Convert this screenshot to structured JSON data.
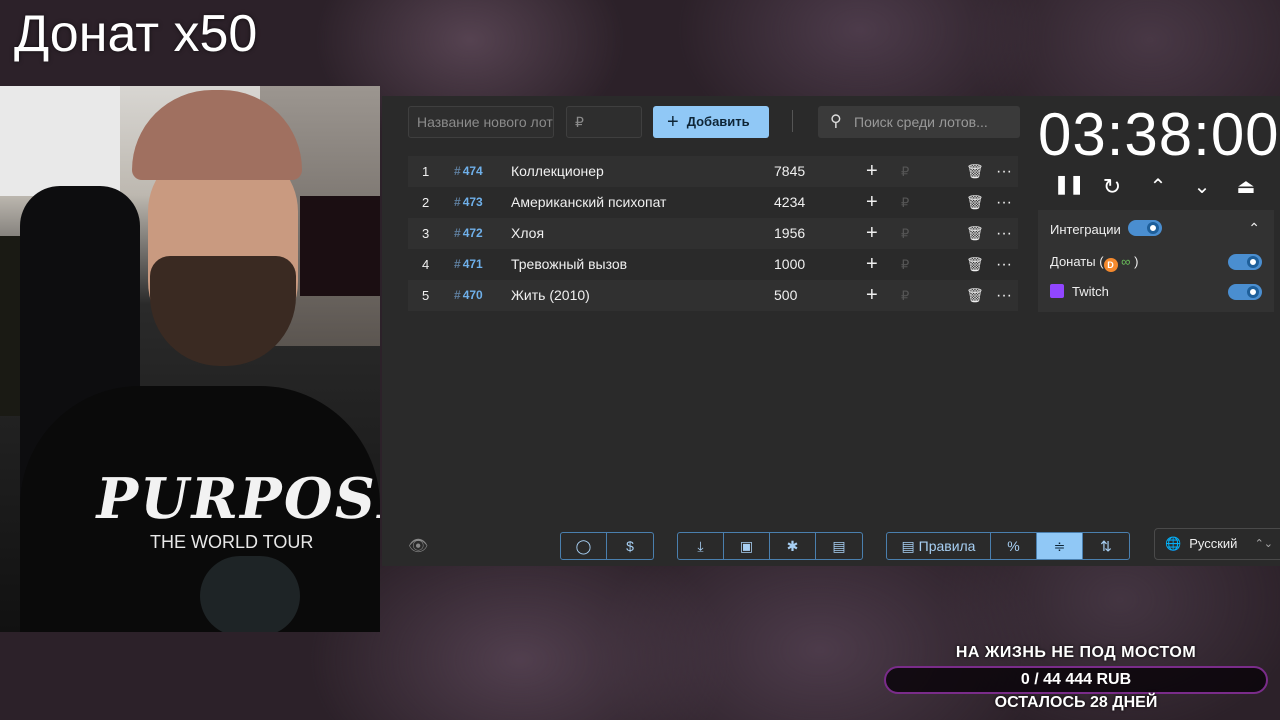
{
  "stream": {
    "title": "Донат x50"
  },
  "webcam": {
    "shirt_text": "PURPOSE",
    "shirt_sub": "THE WORLD TOUR"
  },
  "add_lot": {
    "name_placeholder": "Название нового лота",
    "amount_placeholder": "₽",
    "add_label": "Добавить",
    "search_placeholder": "Поиск среди лотов..."
  },
  "lots": [
    {
      "rank": "1",
      "id": "474",
      "name": "Коллекционер",
      "amount": "7845"
    },
    {
      "rank": "2",
      "id": "473",
      "name": "Американский психопат",
      "amount": "4234"
    },
    {
      "rank": "3",
      "id": "472",
      "name": "Хлоя",
      "amount": "1956"
    },
    {
      "rank": "4",
      "id": "471",
      "name": "Тревожный вызов",
      "amount": "1000"
    },
    {
      "rank": "5",
      "id": "470",
      "name": "Жить (2010)",
      "amount": "500"
    }
  ],
  "row_symbols": {
    "plus": "+",
    "currency": "₽",
    "delete": "🗑",
    "more": "···",
    "hash": "#"
  },
  "timer": {
    "value": "03:38:00",
    "pause": "❚❚",
    "reset": "↻",
    "up": "⌃",
    "down": "⌄",
    "to_top": "⏏"
  },
  "integrations": {
    "header": "Интеграции",
    "enabled": true,
    "collapse_icon": "⌃",
    "donations_label": "Донаты (",
    "donations_close": ")",
    "donations_enabled": true,
    "twitch_label": "Twitch",
    "twitch_enabled": true
  },
  "bottom": {
    "github": "◯",
    "dollar": "$",
    "download": "⤓",
    "save": "▣",
    "bug": "✱",
    "clear": "▤",
    "rules_icon": "▤",
    "rules_label": "Правила",
    "percent": "%",
    "compact": "≑",
    "sort": "⇅",
    "language": "Русский",
    "lang_arrow": "⌃⌄"
  },
  "goal": {
    "title": "НА ЖИЗНЬ НЕ ПОД МОСТОМ",
    "progress_text": "0 / 44 444 RUB",
    "remaining": "ОСТАЛОСЬ 28 ДНЕЙ"
  },
  "colors": {
    "accent": "#90c8f6",
    "id_blue": "#6fb0ea",
    "goal_border": "#7a2c8a",
    "twitch": "#9146ff"
  }
}
